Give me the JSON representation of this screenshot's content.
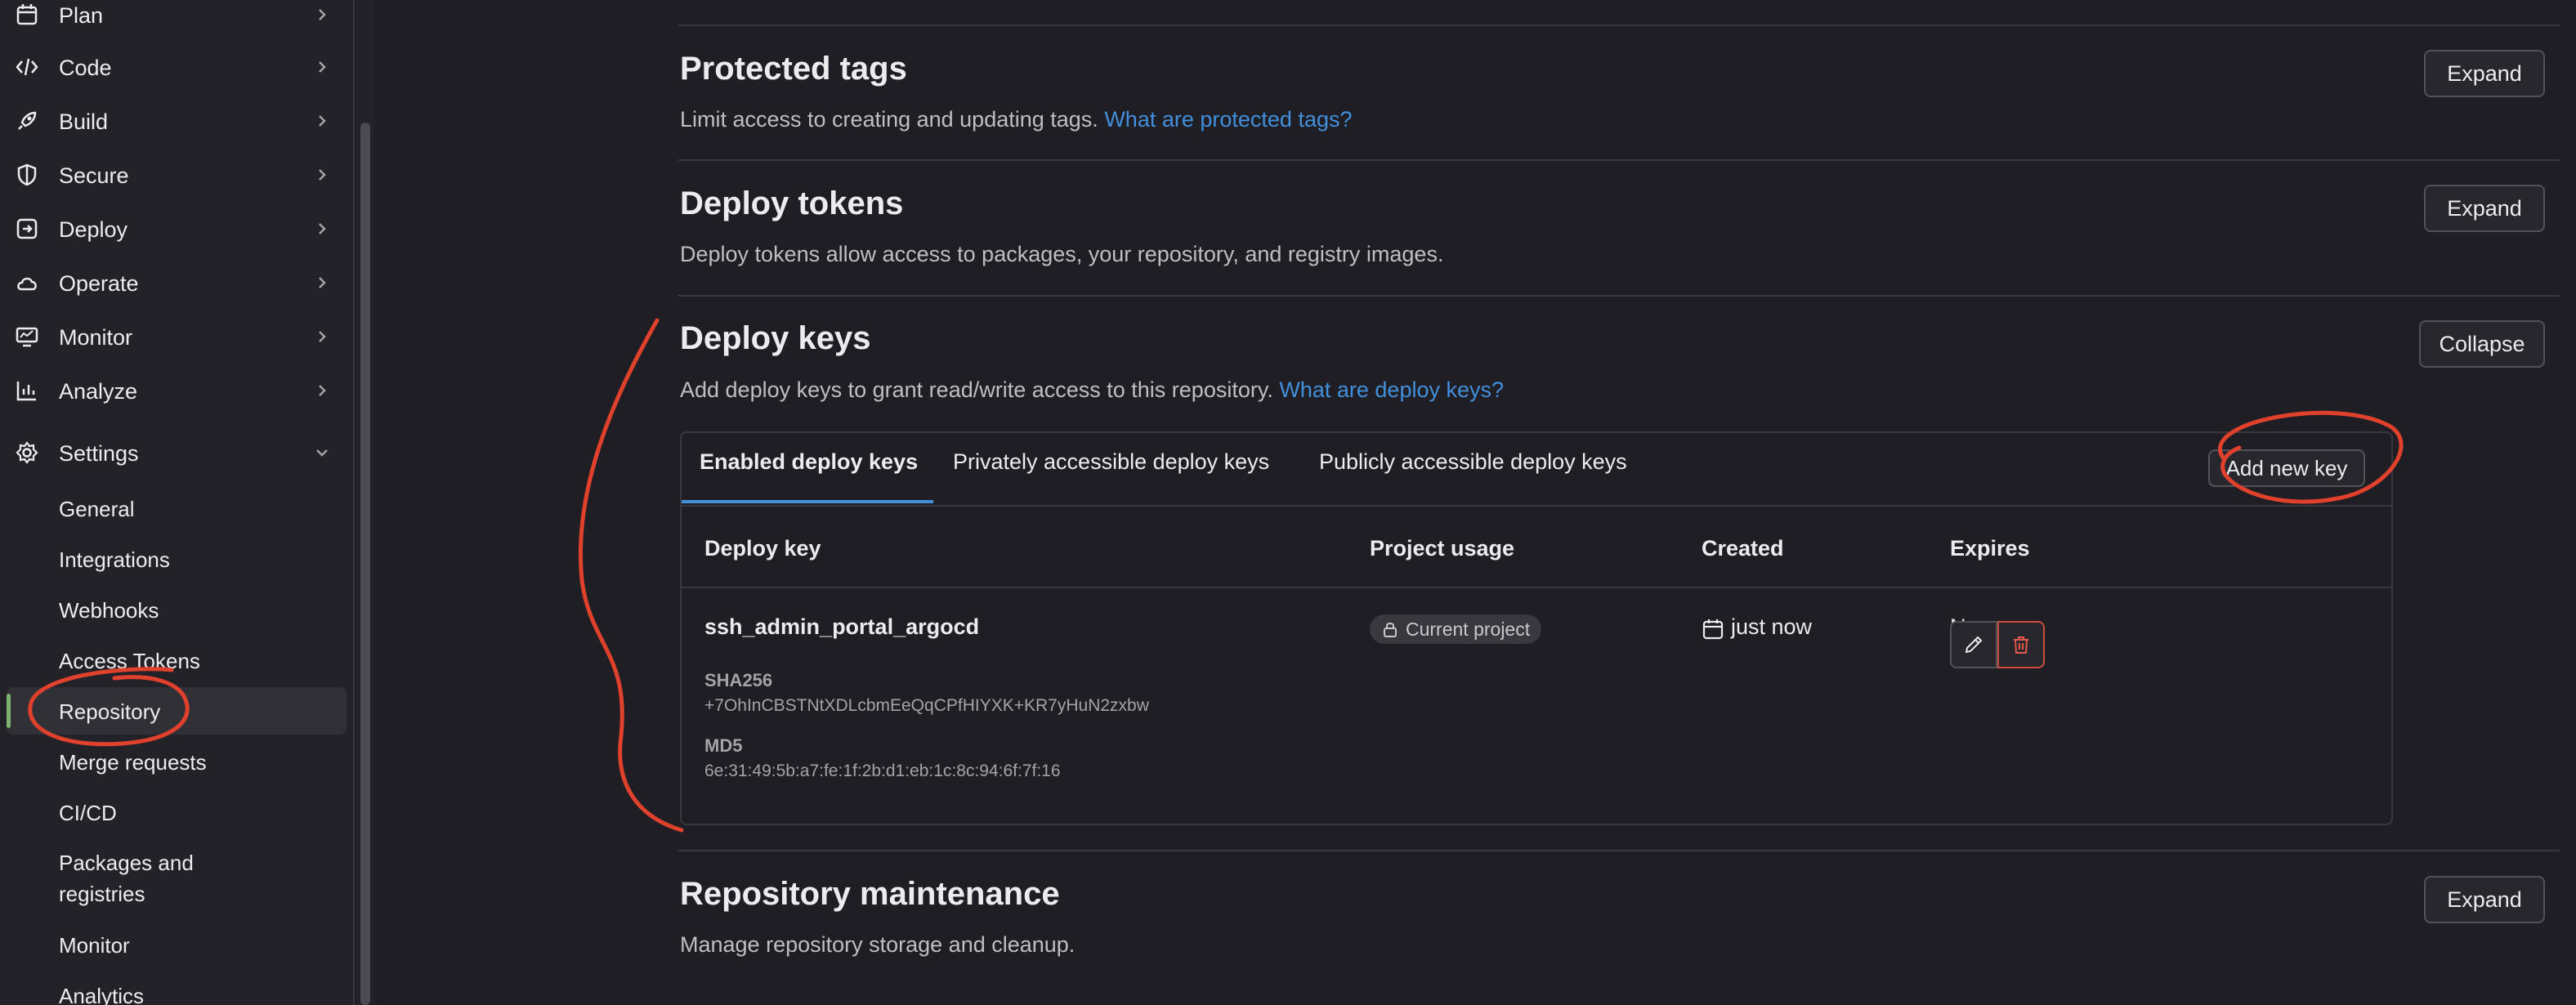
{
  "sidebar": {
    "items": [
      {
        "label": "Plan",
        "icon": "calendar-icon"
      },
      {
        "label": "Code",
        "icon": "code-icon"
      },
      {
        "label": "Build",
        "icon": "rocket-icon"
      },
      {
        "label": "Secure",
        "icon": "shield-icon"
      },
      {
        "label": "Deploy",
        "icon": "deploy-icon"
      },
      {
        "label": "Operate",
        "icon": "cloud-icon"
      },
      {
        "label": "Monitor",
        "icon": "monitor-icon"
      },
      {
        "label": "Analyze",
        "icon": "chart-icon"
      },
      {
        "label": "Settings",
        "icon": "gear-icon"
      }
    ],
    "settings_subitems": [
      "General",
      "Integrations",
      "Webhooks",
      "Access Tokens",
      "Repository",
      "Merge requests",
      "CI/CD",
      "Packages and registries",
      "Monitor",
      "Analytics"
    ],
    "active_subitem": "Repository"
  },
  "sections": {
    "protected_tags": {
      "title": "Protected tags",
      "description": "Limit access to creating and updating tags.",
      "link": "What are protected tags?",
      "button": "Expand"
    },
    "deploy_tokens": {
      "title": "Deploy tokens",
      "description": "Deploy tokens allow access to packages, your repository, and registry images.",
      "button": "Expand"
    },
    "deploy_keys": {
      "title": "Deploy keys",
      "description": "Add deploy keys to grant read/write access to this repository.",
      "link": "What are deploy keys?",
      "button": "Collapse",
      "tabs": [
        "Enabled deploy keys",
        "Privately accessible deploy keys",
        "Publicly accessible deploy keys"
      ],
      "active_tab": "Enabled deploy keys",
      "add_button": "Add new key",
      "columns": [
        "Deploy key",
        "Project usage",
        "Created",
        "Expires"
      ],
      "rows": [
        {
          "name": "ssh_admin_portal_argocd",
          "sha256_label": "SHA256",
          "sha256": "+7OhInCBSTNtXDLcbmEeQqCPfHIYXK+KR7yHuN2zxbw",
          "md5_label": "MD5",
          "md5": "6e:31:49:5b:a7:fe:1f:2b:d1:eb:1c:8c:94:6f:7f:16",
          "project_usage": "Current project",
          "created": "just now",
          "expires": "Never"
        }
      ]
    },
    "repository_maintenance": {
      "title": "Repository maintenance",
      "description": "Manage repository storage and cleanup.",
      "button": "Expand"
    }
  },
  "colors": {
    "background": "#1f1e24",
    "sidebar": "#232228",
    "link": "#428fdc",
    "active_tab_underline": "#428fdc",
    "annotation": "#e0412c",
    "delete": "#c94c40"
  }
}
